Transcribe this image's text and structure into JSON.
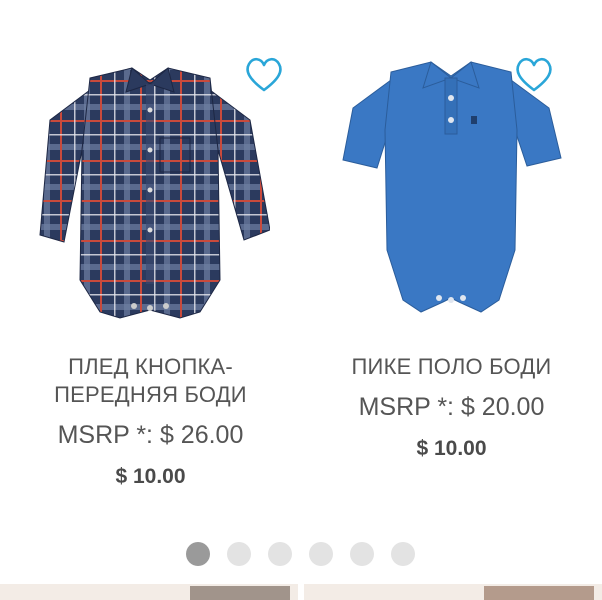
{
  "carousel": {
    "products": [
      {
        "name_line1": "ПЛЕД КНОПКА-",
        "name_line2": "ПЕРЕДНЯЯ БОДИ",
        "msrp": "MSRP *: $ 26.00",
        "price": "$ 10.00",
        "image": "plaid-button-front-bodysuit",
        "favorite_icon": "heart-outline-icon"
      },
      {
        "name_line1": "ПИКЕ ПОЛО БОДИ",
        "msrp": "MSRP *: $ 20.00",
        "price": "$ 10.00",
        "image": "pique-polo-bodysuit",
        "favorite_icon": "heart-outline-icon"
      }
    ],
    "pagination": {
      "total": 6,
      "active_index": 0
    }
  },
  "colors": {
    "heart": "#2aa6d8",
    "text": "#555555",
    "dot_active": "#9a9a9a",
    "dot_inactive": "#e3e3e3",
    "plaid_navy": "#2b3a5e",
    "polo_blue": "#3a78c4"
  }
}
